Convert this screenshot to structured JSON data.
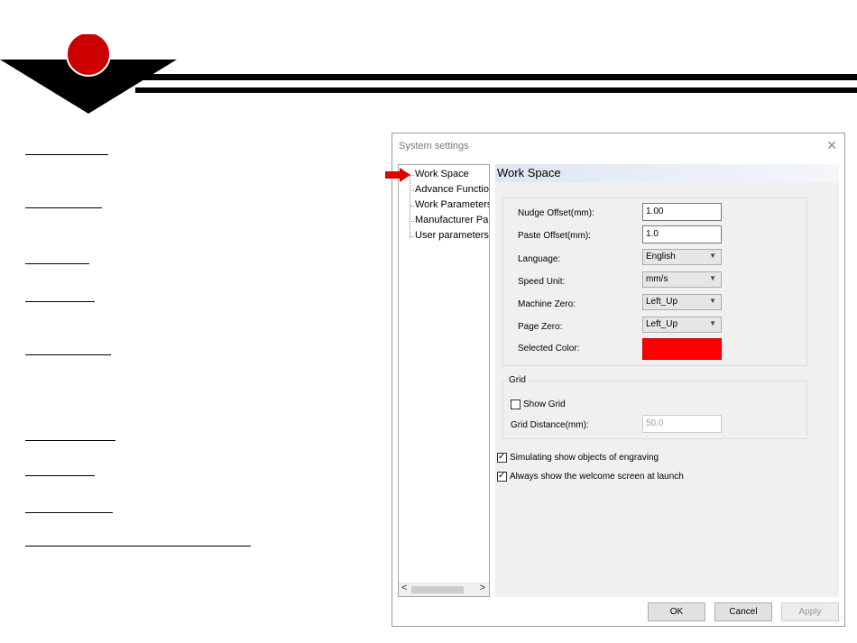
{
  "dialog": {
    "title": "System settings",
    "close_glyph": "✕",
    "tree": {
      "items": [
        {
          "label": "Work Space",
          "selected": true
        },
        {
          "label": "Advance Functions"
        },
        {
          "label": "Work Parameters"
        },
        {
          "label": "Manufacturer Para"
        },
        {
          "label": "User parameters"
        }
      ],
      "scroll_left": "<",
      "scroll_right": ">"
    },
    "panel": {
      "header": "Work Space",
      "fields": {
        "nudge_offset": {
          "label": "Nudge Offset(mm):",
          "value": "1.00"
        },
        "paste_offset": {
          "label": "Paste Offset(mm):",
          "value": "1.0"
        },
        "language": {
          "label": "Language:",
          "value": "English"
        },
        "speed_unit": {
          "label": "Speed Unit:",
          "value": "mm/s"
        },
        "machine_zero": {
          "label": "Machine Zero:",
          "value": "Left_Up"
        },
        "page_zero": {
          "label": "Page Zero:",
          "value": "Left_Up"
        },
        "selected_color": {
          "label": "Selected Color:"
        }
      },
      "grid": {
        "legend": "Grid",
        "show_grid": {
          "label": "Show Grid",
          "checked": false
        },
        "grid_distance": {
          "label": "Grid Distance(mm):",
          "value": "50.0"
        }
      },
      "simulating_show": {
        "label": "Simulating show objects of engraving",
        "checked": true
      },
      "always_show_welcome": {
        "label": "Always show the welcome screen at launch",
        "checked": true
      }
    },
    "buttons": {
      "ok": "OK",
      "cancel": "Cancel",
      "apply": "Apply"
    }
  },
  "colors": {
    "logo_red": "#cc0000",
    "arrow_red": "#e00000",
    "selected_color_swatch": "#ff0000"
  }
}
